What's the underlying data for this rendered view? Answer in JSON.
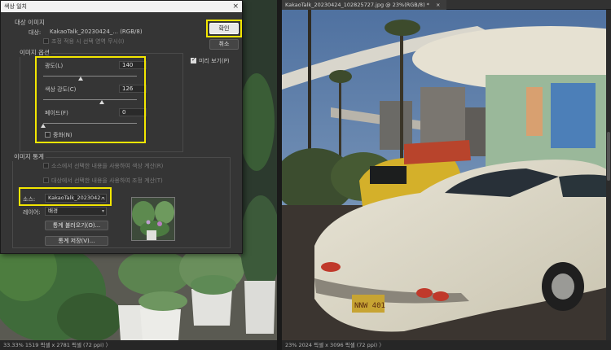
{
  "dialog": {
    "title": "색상 일치",
    "close_glyph": "×",
    "target_section": "대상 이미지",
    "target_label": "대상:",
    "target_value": "KakaoTalk_20230424_... (RGB/8)",
    "ignore_selection_label": "조정 적용 시 선택 영역 무시(I)",
    "image_options_section": "이미지 옵션",
    "luminance_label": "광도(L)",
    "luminance_value": "140",
    "luminance_fraction": 0.4,
    "color_intensity_label": "색상 강도(C)",
    "color_intensity_value": "126",
    "color_intensity_fraction": 0.63,
    "fade_label": "페이드(F)",
    "fade_value": "0",
    "fade_fraction": 0.0,
    "neutralize_label": "중화(N)",
    "image_stats_section": "이미지 통계",
    "use_selection_source_label": "소스에서 선택한 내용을 사용하여 색상 계산(R)",
    "use_selection_target_label": "대상에서 선택한 내용을 사용하여 조정 계산(T)",
    "source_label": "소스:",
    "source_value": "KakaoTalk_2023042...",
    "layer_label": "레이어:",
    "layer_value": "배경",
    "load_stats_button": "통계 불러오기(O)...",
    "save_stats_button": "통계 저장(V)...",
    "ok_button": "확인",
    "cancel_button": "취소",
    "preview_label": "미리 보기(P)"
  },
  "left_doc": {
    "status": "33.33%  1519 픽셀 x 2781 픽셀 (72 ppi)  〉"
  },
  "right_doc": {
    "tab_title": "KakaoTalk_20230424_102825727.jpg @ 23%(RGB/8) *",
    "tab_close": "×",
    "status": "23%   2024 픽셀 x 3096 픽셀 (72 ppi)  〉"
  },
  "colors": {
    "highlight": "#f2e600",
    "dialog_bg": "#353535",
    "sky": "#5e7fa8"
  }
}
